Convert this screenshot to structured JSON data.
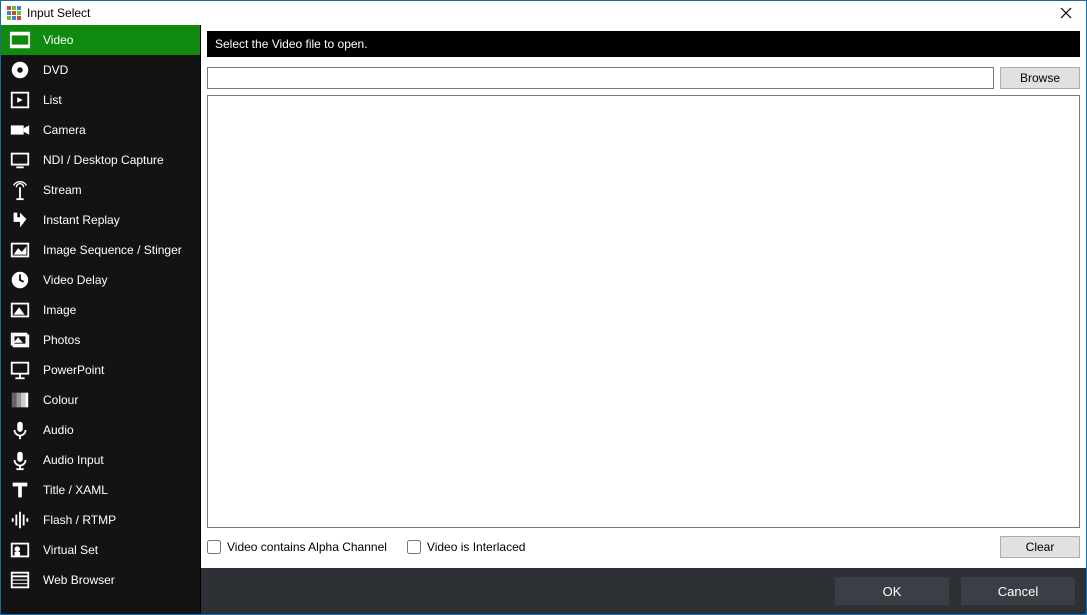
{
  "window": {
    "title": "Input Select"
  },
  "sidebar": {
    "items": [
      {
        "label": "Video",
        "icon": "video-clip-icon",
        "selected": true
      },
      {
        "label": "DVD",
        "icon": "disc-icon"
      },
      {
        "label": "List",
        "icon": "list-play-icon"
      },
      {
        "label": "Camera",
        "icon": "camera-icon"
      },
      {
        "label": "NDI / Desktop Capture",
        "icon": "monitor-icon"
      },
      {
        "label": "Stream",
        "icon": "antenna-icon"
      },
      {
        "label": "Instant Replay",
        "icon": "replay-icon"
      },
      {
        "label": "Image Sequence / Stinger",
        "icon": "image-sequence-icon"
      },
      {
        "label": "Video Delay",
        "icon": "clock-icon"
      },
      {
        "label": "Image",
        "icon": "image-icon"
      },
      {
        "label": "Photos",
        "icon": "photos-icon"
      },
      {
        "label": "PowerPoint",
        "icon": "presentation-icon"
      },
      {
        "label": "Colour",
        "icon": "colour-bars-icon"
      },
      {
        "label": "Audio",
        "icon": "microphone-icon"
      },
      {
        "label": "Audio Input",
        "icon": "microphone-input-icon"
      },
      {
        "label": "Title / XAML",
        "icon": "title-icon"
      },
      {
        "label": "Flash / RTMP",
        "icon": "waveform-icon"
      },
      {
        "label": "Virtual Set",
        "icon": "virtual-set-icon"
      },
      {
        "label": "Web Browser",
        "icon": "browser-icon"
      }
    ]
  },
  "main": {
    "instruction": "Select the Video file to open.",
    "path_value": "",
    "browse_label": "Browse",
    "clear_label": "Clear",
    "checkbox_alpha": "Video contains Alpha Channel",
    "checkbox_interlaced": "Video is Interlaced"
  },
  "footer": {
    "ok_label": "OK",
    "cancel_label": "Cancel"
  }
}
